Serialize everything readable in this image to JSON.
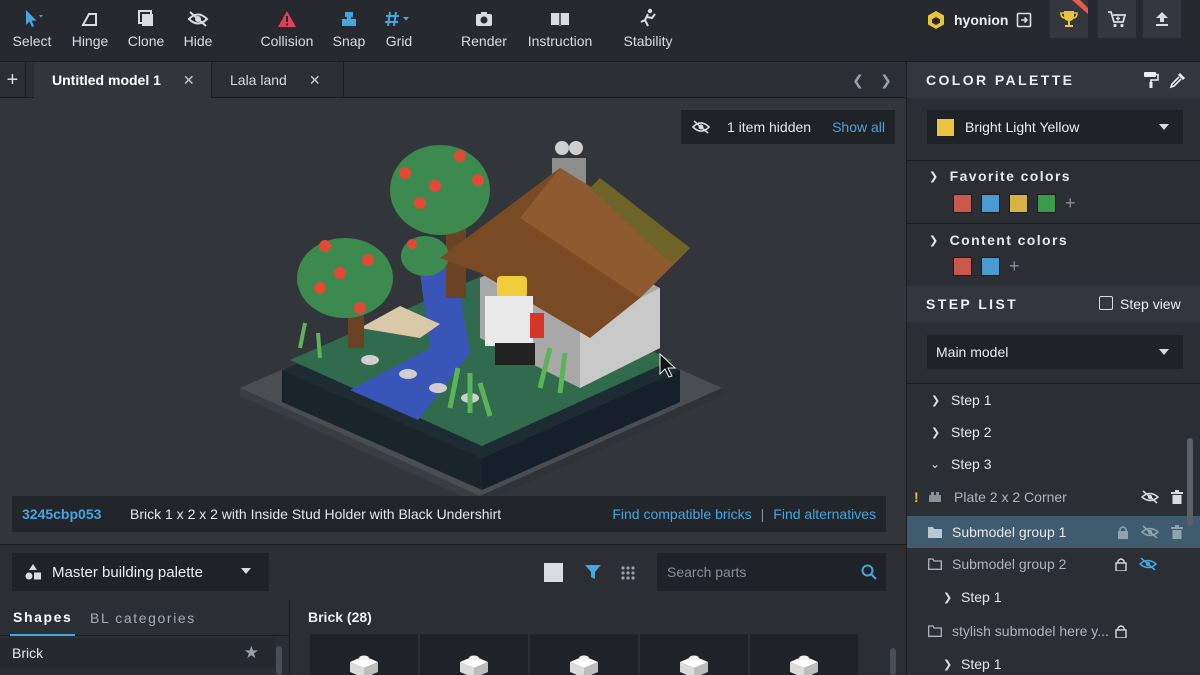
{
  "toolbar": {
    "tools": [
      {
        "label": "Select",
        "icon": "cursor-icon"
      },
      {
        "label": "Hinge",
        "icon": "hinge-icon"
      },
      {
        "label": "Clone",
        "icon": "clone-icon"
      },
      {
        "label": "Hide",
        "icon": "eye-off-icon"
      },
      {
        "label": "Collision",
        "icon": "warning-triangle-icon"
      },
      {
        "label": "Snap",
        "icon": "snap-icon"
      },
      {
        "label": "Grid",
        "icon": "grid-icon"
      },
      {
        "label": "Render",
        "icon": "camera-icon"
      },
      {
        "label": "Instruction",
        "icon": "book-icon"
      },
      {
        "label": "Stability",
        "icon": "stability-icon"
      }
    ],
    "username": "hyonion"
  },
  "tabs": [
    {
      "label": "Untitled model 1",
      "active": true
    },
    {
      "label": "Lala land",
      "active": false
    }
  ],
  "viewport": {
    "hidden_text": "1 item hidden",
    "show_all": "Show all",
    "part_id": "3245cbp053",
    "part_name": "Brick 1 x 2 x 2 with Inside Stud Holder with Black Undershirt",
    "find_compatible": "Find compatible bricks",
    "link_separator": "|",
    "find_alternatives": "Find alternatives"
  },
  "palette_bar": {
    "palette_name": "Master building palette",
    "search_placeholder": "Search parts"
  },
  "parts": {
    "tab_shapes": "Shapes",
    "tab_bl": "BL categories",
    "shape_item": "Brick",
    "category_title": "Brick (28)"
  },
  "color_palette": {
    "title": "COLOR PALETTE",
    "selected_color": "Bright Light Yellow",
    "selected_hex": "#e8c53c",
    "favorite_title": "Favorite colors",
    "favorite_colors": [
      "#c9584d",
      "#4a9bd1",
      "#d6b342",
      "#3c9a4b"
    ],
    "content_title": "Content colors",
    "content_colors": [
      "#c9584d",
      "#4a9bd1"
    ]
  },
  "step_list": {
    "title": "STEP LIST",
    "step_view": "Step view",
    "model": "Main model",
    "rows": [
      {
        "label": "Step 1"
      },
      {
        "label": "Step 2"
      },
      {
        "label": "Step 3"
      },
      {
        "label": "Plate 2 x 2 Corner"
      },
      {
        "label": "Submodel group 1"
      },
      {
        "label": "Submodel group 2"
      },
      {
        "label": "Step 1"
      },
      {
        "label": "stylish submodel here y..."
      },
      {
        "label": "Step 1"
      }
    ]
  },
  "colors": {
    "accent": "#45a6e0",
    "warning": "#e8c53c",
    "collision": "#e0405a"
  }
}
